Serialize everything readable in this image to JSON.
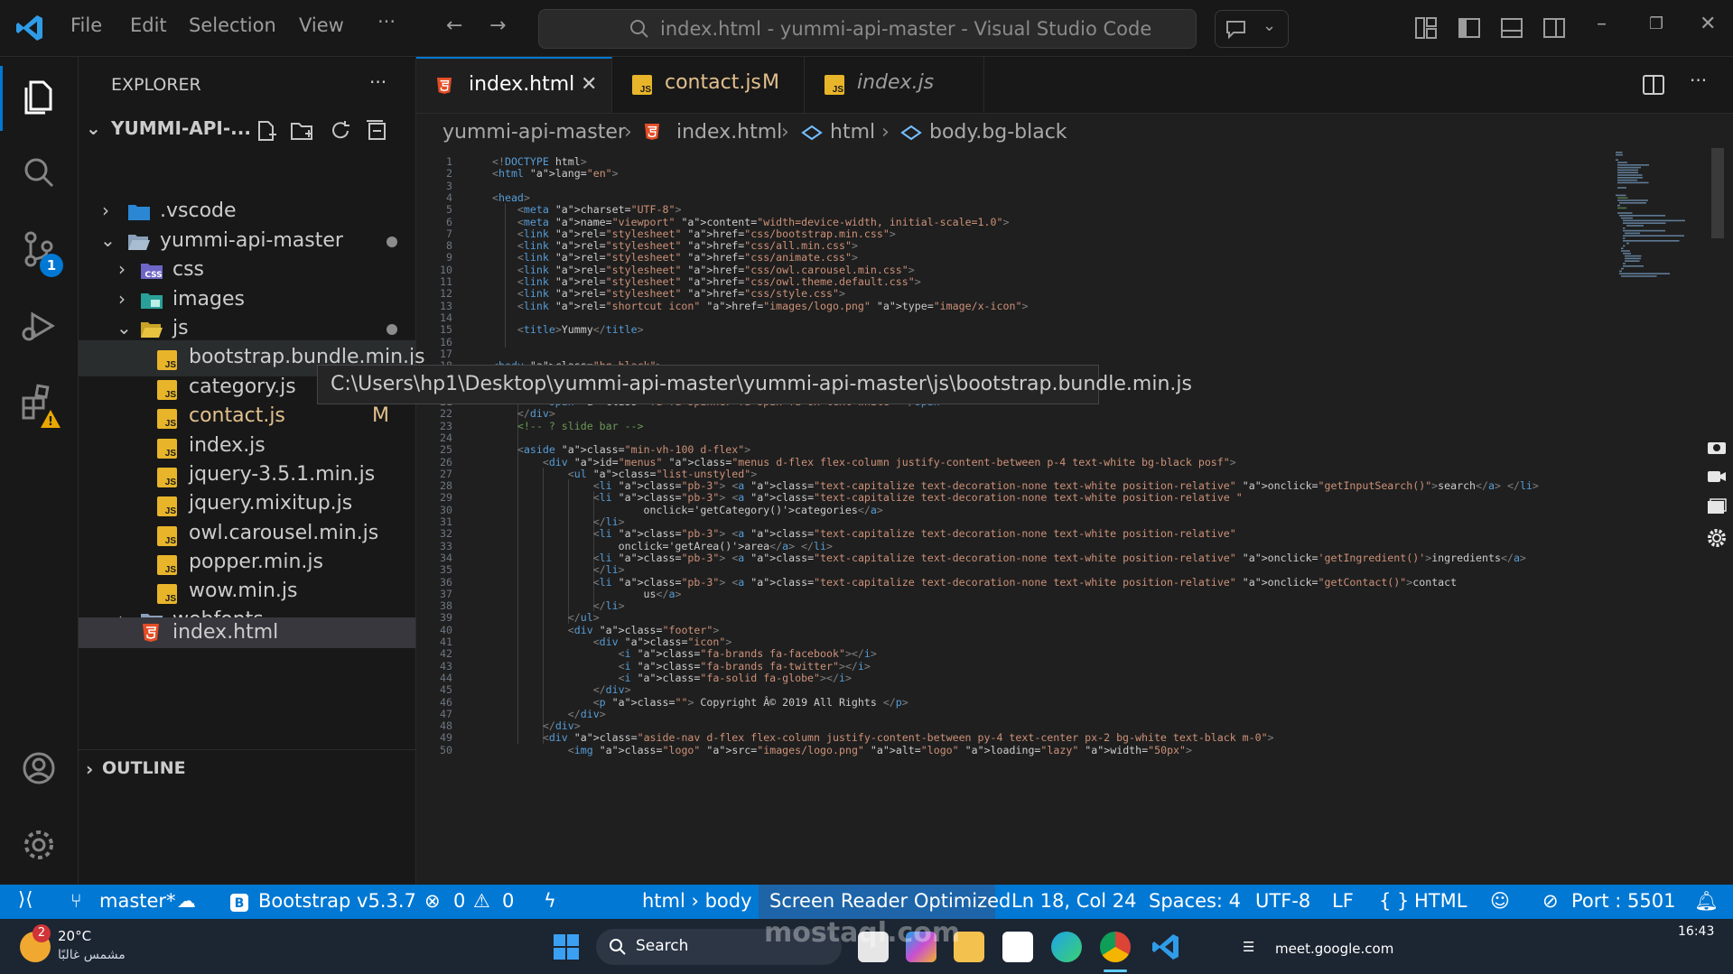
{
  "window": {
    "title": "index.html - yummi-api-master - Visual Studio Code"
  },
  "menu": [
    "File",
    "Edit",
    "Selection",
    "View",
    "···"
  ],
  "sidebar": {
    "title": "EXPLORER",
    "more": "···",
    "project": "YUMMI-API-...",
    "tree": [
      {
        "label": ".vscode",
        "type": "folder",
        "level": 1,
        "expanded": false
      },
      {
        "label": "yummi-api-master",
        "type": "folder",
        "level": 1,
        "expanded": true,
        "modified_dot": true
      },
      {
        "label": "css",
        "type": "folder",
        "level": 2,
        "expanded": false
      },
      {
        "label": "images",
        "type": "folder",
        "level": 2,
        "expanded": false
      },
      {
        "label": "js",
        "type": "folder",
        "level": 2,
        "expanded": true,
        "modified_dot": true
      },
      {
        "label": "bootstrap.bundle.min.js",
        "type": "js",
        "level": 3
      },
      {
        "label": "category.js",
        "type": "js",
        "level": 3
      },
      {
        "label": "contact.js",
        "type": "js",
        "level": 3,
        "badge": "M"
      },
      {
        "label": "index.js",
        "type": "js",
        "level": 3
      },
      {
        "label": "jquery-3.5.1.min.js",
        "type": "js",
        "level": 3
      },
      {
        "label": "jquery.mixitup.js",
        "type": "js",
        "level": 3
      },
      {
        "label": "owl.carousel.min.js",
        "type": "js",
        "level": 3
      },
      {
        "label": "popper.min.js",
        "type": "js",
        "level": 3
      },
      {
        "label": "wow.min.js",
        "type": "js",
        "level": 3
      },
      {
        "label": "webfonts",
        "type": "folder",
        "level": 2,
        "expanded": false
      },
      {
        "label": "index.html",
        "type": "html",
        "level": 2,
        "selected": true
      }
    ],
    "outline": "OUTLINE"
  },
  "activity": {
    "scm_badge": "1"
  },
  "tabs": [
    {
      "label": "index.html",
      "icon": "html5-icon",
      "active": true
    },
    {
      "label": "contact.js",
      "badge": "M",
      "icon": "js-icon"
    },
    {
      "label": "index.js",
      "icon": "js-icon",
      "italic": true
    }
  ],
  "breadcrumb": [
    "yummi-api-master",
    "index.html",
    "html",
    "body.bg-black"
  ],
  "tooltip": "C:\\Users\\hp1\\Desktop\\yummi-api-master\\yummi-api-master\\js\\bootstrap.bundle.min.js",
  "code": [
    "<!DOCTYPE html>",
    "<html lang=\"en\">",
    "",
    "<head>",
    "    <meta charset=\"UTF-8\">",
    "    <meta name=\"viewport\" content=\"width=device-width, initial-scale=1.0\">",
    "    <link rel=\"stylesheet\" href=\"css/bootstrap.min.css\">",
    "    <link rel=\"stylesheet\" href=\"css/all.min.css\">",
    "    <link rel=\"stylesheet\" href=\"css/animate.css\">",
    "    <link rel=\"stylesheet\" href=\"css/owl.carousel.min.css\">",
    "    <link rel=\"stylesheet\" href=\"css/owl.theme.default.css\">",
    "    <link rel=\"stylesheet\" href=\"css/style.css\">",
    "    <link rel=\"shortcut icon\" href=\"images/logo.png\" type=\"image/x-icon\">",
    "",
    "    <title>Yummy</title>",
    "",
    "",
    "<body class=\"bg-black\">",
    "    <!-- * loading page -->",
    "    <div id=\"loading\" class=\"justify-content-center align-items-center\">",
    "        <span class=\"fa fa-spinner fa-spin fa-6x text-white\"></span>",
    "    </div>",
    "    <!-- ? slide bar -->",
    "",
    "    <aside class=\"min-vh-100 d-flex\">",
    "        <div id=\"menus\" class=\"menus d-flex flex-column justify-content-between p-4 text-white bg-black posf\">",
    "            <ul class=\"list-unstyled\">",
    "                <li class=\"pb-3\"> <a class=\"text-capitalize text-decoration-none text-white position-relative\" onclick=\"getInputSearch()\">search</a> </li>",
    "                <li class=\"pb-3\"> <a class=\"text-capitalize text-decoration-none text-white position-relative \"",
    "                        onclick='getCategory()'>categories</a>",
    "                </li>",
    "                <li class=\"pb-3\"> <a class=\"text-capitalize text-decoration-none text-white position-relative\"",
    "                    onclick='getArea()'>area</a> </li>",
    "                <li class=\"pb-3\"> <a class=\"text-capitalize text-decoration-none text-white position-relative\" onclick='getIngredient()'>ingredients</a>",
    "                </li>",
    "                <li class=\"pb-3\"> <a class=\"text-capitalize text-decoration-none text-white position-relative\" onclick=\"getContact()\">contact",
    "                        us</a>",
    "                </li>",
    "            </ul>",
    "            <div class=\"footer\">",
    "                <div class=\"icon\">",
    "                    <i class=\"fa-brands fa-facebook\"></i>",
    "                    <i class=\"fa-brands fa-twitter\"></i>",
    "                    <i class=\"fa-solid fa-globe\"></i>",
    "                </div>",
    "                <p class=\"\"> Copyright Â© 2019 All Rights </p>",
    "            </div>",
    "        </div>",
    "        <div class=\"aside-nav d-flex flex-column justify-content-between py-4 text-center px-2 bg-white text-black m-0\">",
    "            <img class=\"logo\" src=\"images/logo.png\" alt=\"logo\" loading=\"lazy\" width=\"50px\">"
  ],
  "status": {
    "branch": "master*",
    "bootstrap": "Bootstrap v5.3.7",
    "errors": "0",
    "warnings": "0",
    "path": "html › body",
    "screen_reader": "Screen Reader Optimized",
    "cursor": "Ln 18, Col 24",
    "spaces": "Spaces: 4",
    "encoding": "UTF-8",
    "eol": "LF",
    "language": "HTML",
    "port": "Port : 5501"
  },
  "taskbar": {
    "weather_temp": "20°C",
    "weather_desc": "مشمس غالبًا",
    "weather_badge": "2",
    "search": "Search",
    "time": "16:43",
    "chrome_tab": "meet.google.com",
    "watermark": "mostaql.com"
  },
  "colors": {
    "accent": "#0078d4",
    "tag": "#569cd6",
    "attr": "#9cdcfe",
    "string": "#ce9178",
    "comment": "#6a9955"
  }
}
